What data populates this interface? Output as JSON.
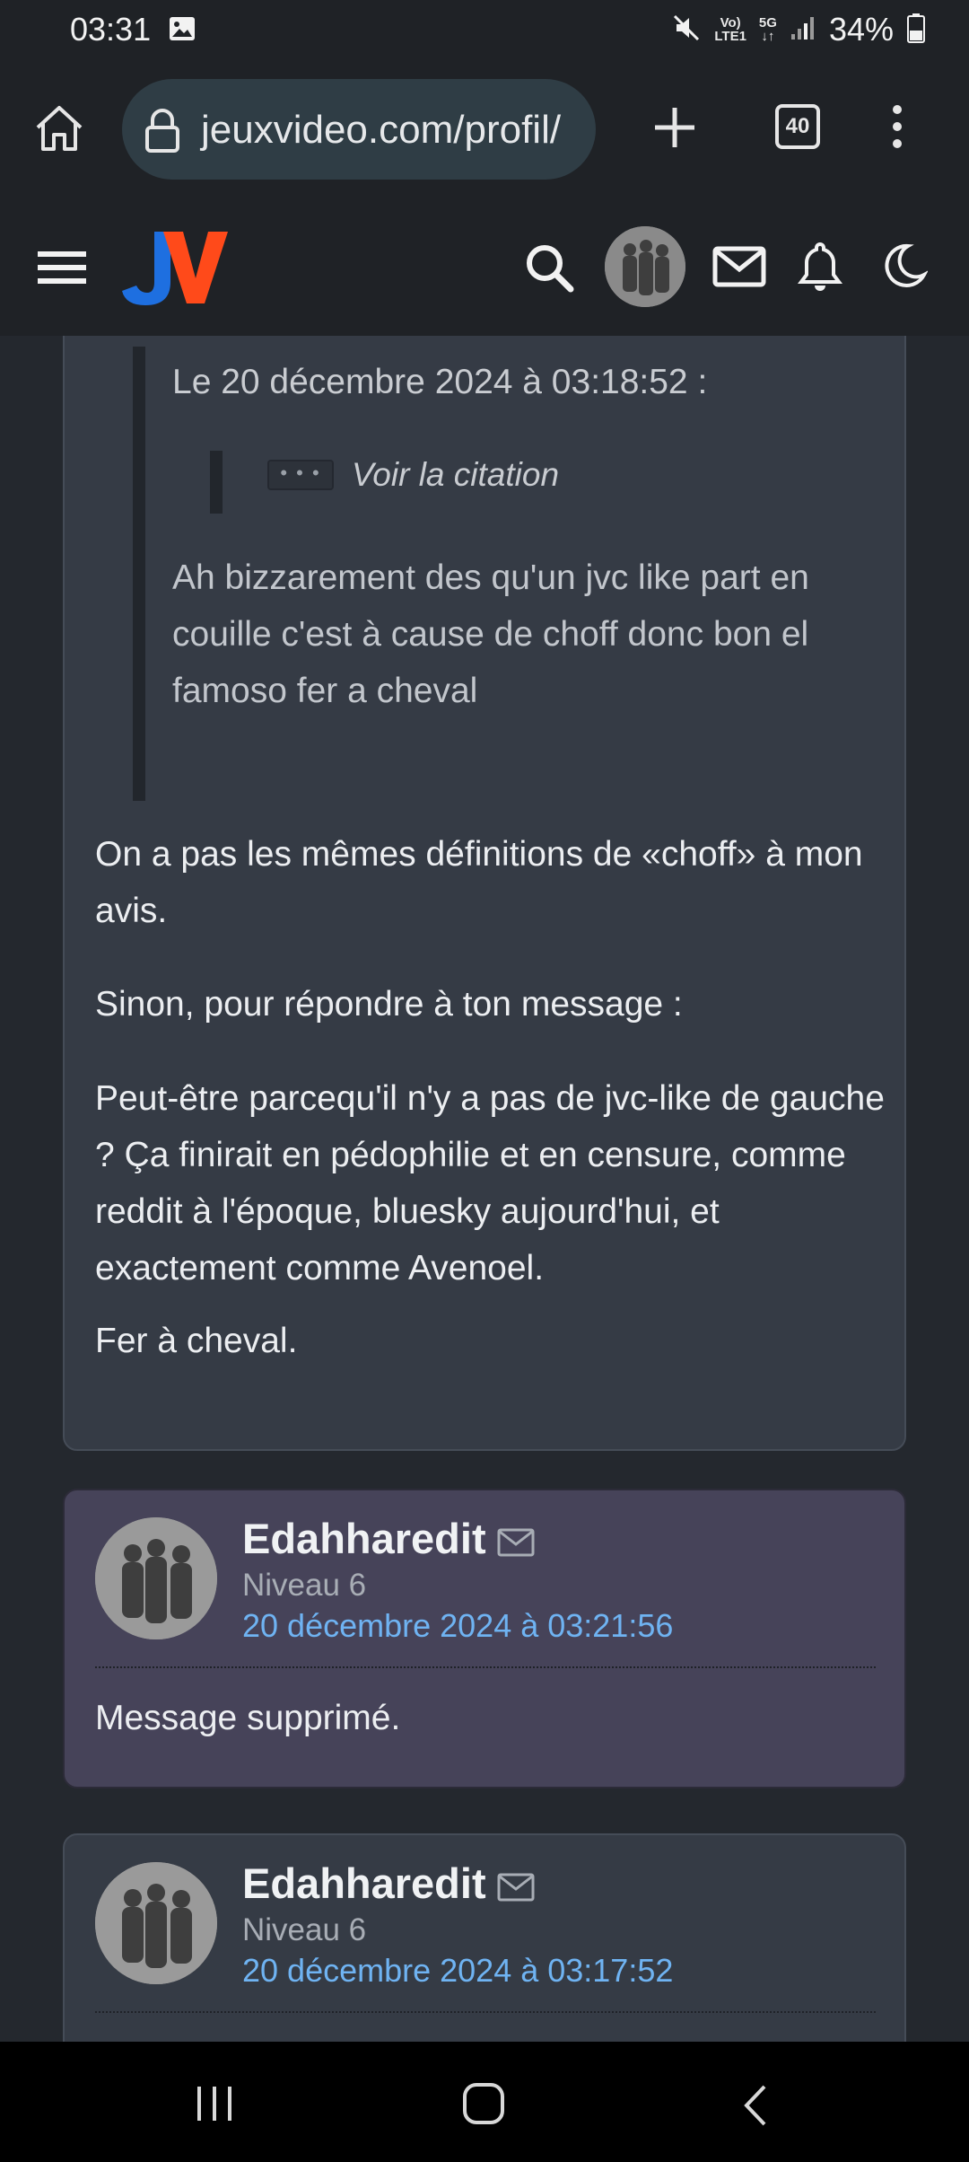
{
  "status_bar": {
    "time": "03:31",
    "network_top": "Vo)",
    "network_bottom": "LTE1",
    "network_5g": "5G",
    "battery": "34%"
  },
  "browser": {
    "url": "jeuxvideo.com/profil/",
    "tab_count": "40"
  },
  "colors": {
    "accent_blue": "#6fb3f2",
    "logo_j": "#1e6fe0",
    "logo_v": "#ff4a1a",
    "card_bg": "#353b45",
    "highlight_card_bg": "#464359"
  },
  "post": {
    "quote_header": "Le 20 décembre 2024 à 03:18:52 :",
    "quote_toggle": "• • •",
    "quote_link": "Voir la citation",
    "quote_text": "Ah bizzarement des qu'un jvc like part en couille c'est à cause de choff donc bon el famoso fer a cheval",
    "paragraphs": [
      "On a pas les mêmes définitions de «choff» à mon avis.",
      "Sinon, pour répondre à ton message :",
      "Peut-être parcequ'il n'y a pas de jvc-like de gauche ? Ça finirait en pédophilie et en censure, comme reddit à l'époque, bluesky aujourd'hui, et exactement comme Avenoel.",
      "Fer à cheval."
    ]
  },
  "messages": [
    {
      "author": "Edahharedit",
      "level": "Niveau 6",
      "date": "20 décembre 2024 à 03:21:56",
      "body": "Message supprimé."
    },
    {
      "author": "Edahharedit",
      "level": "Niveau 6",
      "date": "20 décembre 2024 à 03:17:52"
    }
  ]
}
